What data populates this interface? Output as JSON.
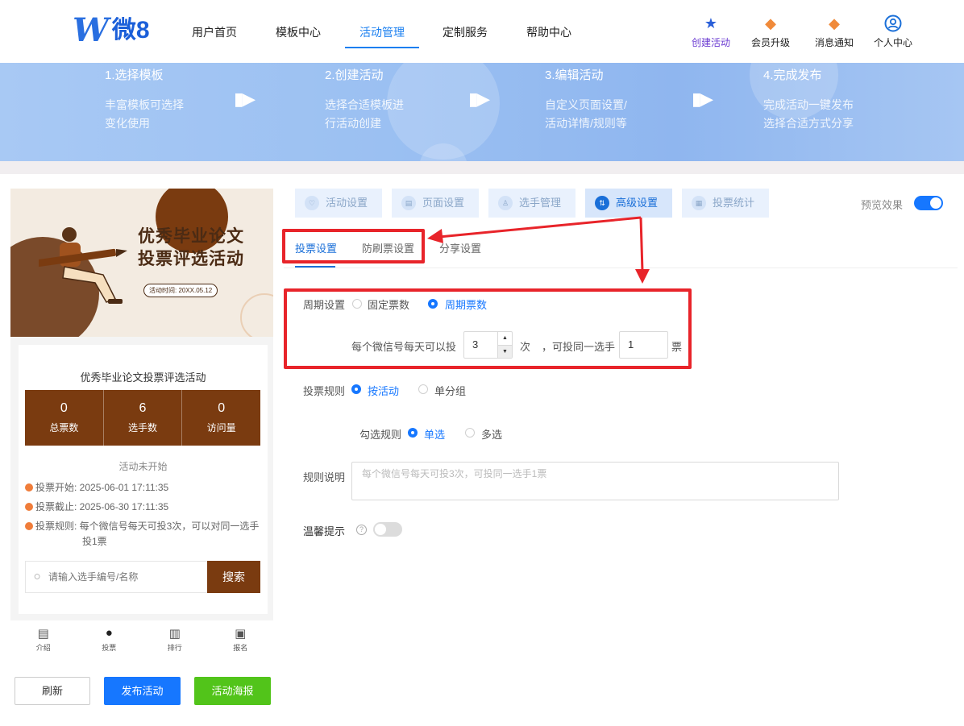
{
  "logo": {
    "mark": "W",
    "text": "微8"
  },
  "nav": [
    "用户首页",
    "模板中心",
    "活动管理",
    "定制服务",
    "帮助中心"
  ],
  "tools": [
    {
      "icon": "star-icon",
      "label": "创建活动"
    },
    {
      "icon": "diamond-icon",
      "label": "会员升级"
    },
    {
      "icon": "bell-icon",
      "label": "消息通知"
    },
    {
      "icon": "user-icon",
      "label": "个人中心"
    }
  ],
  "steps": [
    {
      "title": "1.选择模板",
      "line1": "丰富模板可选择",
      "line2": "变化使用"
    },
    {
      "title": "2.创建活动",
      "line1": "选择合适模板进",
      "line2": "行活动创建"
    },
    {
      "title": "3.编辑活动",
      "line1": "自定义页面设置/",
      "line2": "活动详情/规则等"
    },
    {
      "title": "4.完成发布",
      "line1": "完成活动一键发布",
      "line2": "选择合适方式分享"
    }
  ],
  "preview": {
    "poster_title_1": "优秀毕业论文",
    "poster_title_2": "投票评选活动",
    "poster_date": "活动时间: 20XX.05.12",
    "activity_name": "优秀毕业论文投票评选活动",
    "stats": [
      {
        "value": "0",
        "label": "总票数"
      },
      {
        "value": "6",
        "label": "选手数"
      },
      {
        "value": "0",
        "label": "访问量"
      }
    ],
    "status": "活动未开始",
    "vote_start": "投票开始: 2025-06-01 17:11:35",
    "vote_end": "投票截止: 2025-06-30 17:11:35",
    "vote_rule_1": "投票规则: 每个微信号每天可投3次，可以对同一选手",
    "vote_rule_2": "投1票",
    "search_placeholder": "请输入选手编号/名称",
    "search_button": "搜索",
    "tabbar": [
      {
        "icon": "doc-icon",
        "label": "介绍"
      },
      {
        "icon": "person-icon",
        "label": "投票"
      },
      {
        "icon": "bars-icon",
        "label": "排行"
      },
      {
        "icon": "form-icon",
        "label": "报名"
      }
    ]
  },
  "buttons": {
    "refresh": "刷新",
    "publish": "发布活动",
    "poster": "活动海报"
  },
  "main_tabs": [
    "活动设置",
    "页面设置",
    "选手管理",
    "高级设置",
    "投票统计"
  ],
  "preview_toggle_label": "预览效果",
  "sub_tabs": [
    "投票设置",
    "防刷票设置",
    "分享设置"
  ],
  "form": {
    "cycle_label": "周期设置",
    "cycle_options": [
      "固定票数",
      "周期票数"
    ],
    "per_day_text": "每个微信号每天可以投",
    "times_value": "3",
    "times_unit": "次",
    "same_player_text": "，可投同一选手",
    "votes_value": "1",
    "votes_unit": "票",
    "rule_label": "投票规则",
    "rule_options": [
      "按活动",
      "单分组"
    ],
    "check_label": "勾选规则",
    "check_options": [
      "单选",
      "多选"
    ],
    "desc_label": "规则说明",
    "desc_placeholder": "每个微信号每天可投3次，可投同一选手1票",
    "tip_label": "温馨提示",
    "help_glyph": "?"
  },
  "colors": {
    "brand_blue": "#1677ff",
    "brown": "#7a3b10",
    "annotation_red": "#e8242a",
    "green": "#52c41a"
  }
}
